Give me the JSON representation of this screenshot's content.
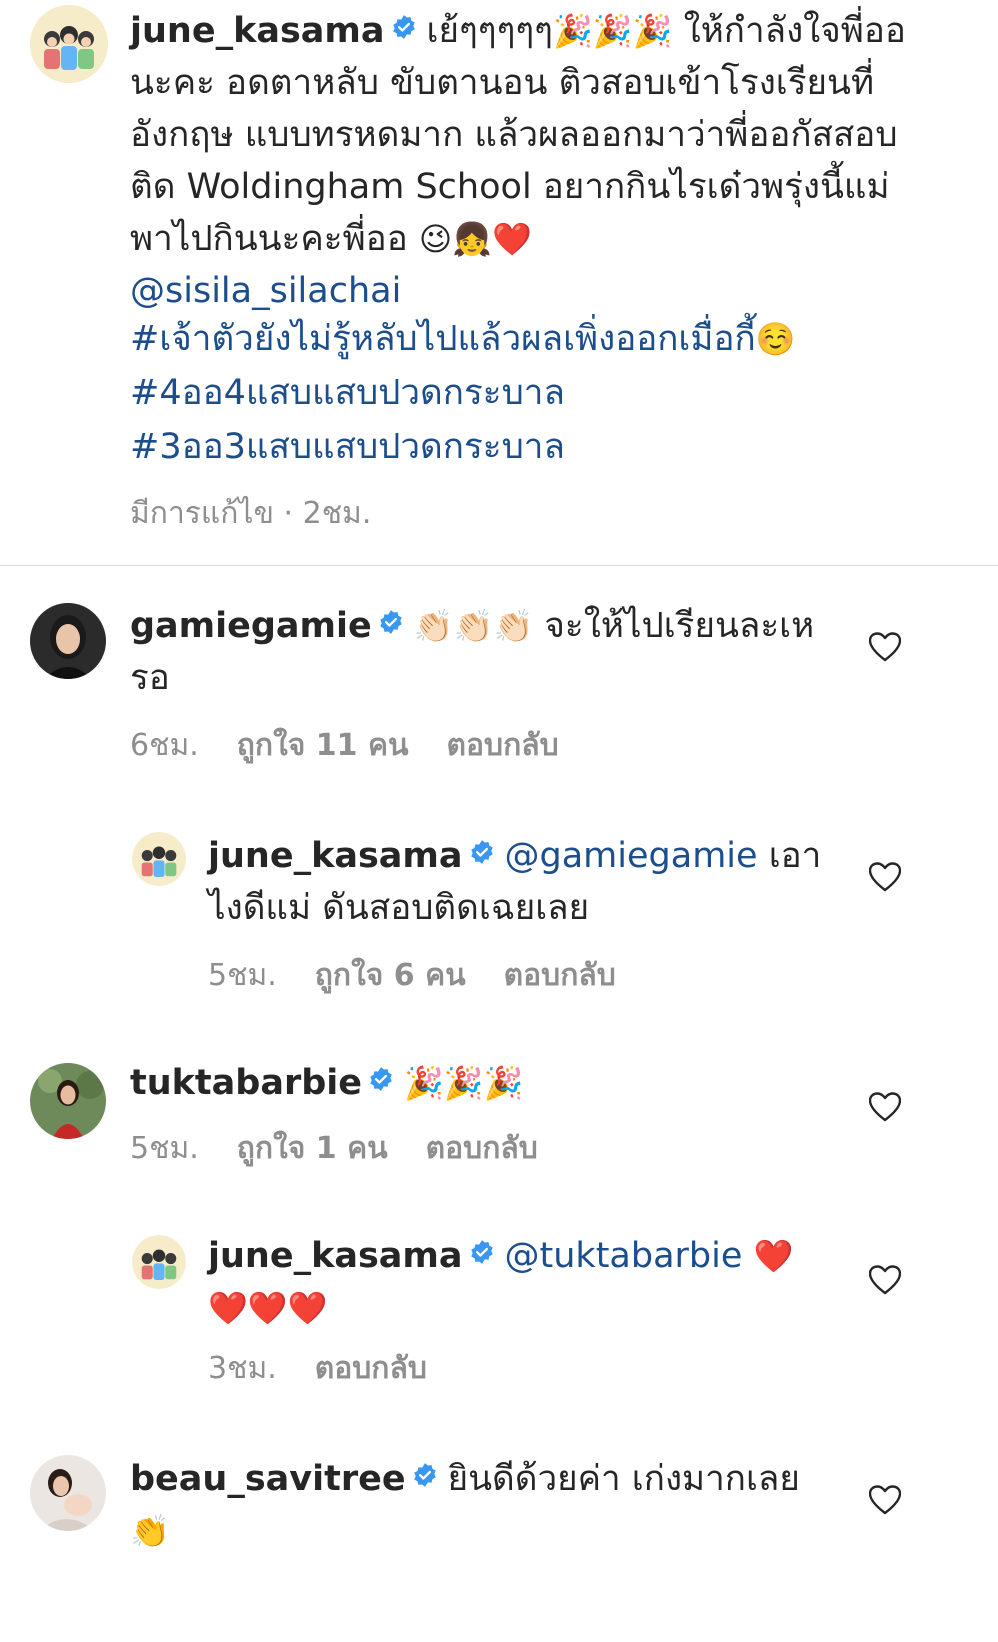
{
  "caption": {
    "username": "june_kasama",
    "text_part1": "เย้ๆๆๆๆๆ",
    "party_emojis": "🎉🎉🎉",
    "text_part2": " ให้กำลังใจพี่ออนะคะ อดตาหลับ ขับตานอน ติวสอบเข้าโรงเรียนที่อังกฤษ แบบทรหดมาก แล้วผลออกมาว่าพี่ออกัสสอบติด Woldingham School  อยากกินไรเด๋วพรุ่งนี้แม่พาไปกินนะคะพี่ออ ",
    "end_emojis": "😉👧❤️",
    "mention": "@sisila_silachai",
    "hashtags": [
      "#เจ้าตัวยังไม่รู้หลับไปแล้วผลเพิ่งออกเมื่อกี้",
      "#4ออ4แสบแสบปวดกระบาล",
      "#3ออ3แสบแสบปวดกระบาล"
    ],
    "hashtag_emoji": "☺️",
    "meta": "มีการแก้ไข · 2ชม."
  },
  "comments": [
    {
      "username": "gamiegamie",
      "emojis": "👏🏻👏🏻👏🏻",
      "text": " จะให้ไปเรียนละเหรอ",
      "time": "6ชม.",
      "likes": "ถูกใจ 11 คน",
      "reply": "ตอบกลับ"
    },
    {
      "username": "june_kasama",
      "mention": "@gamiegamie",
      "text": " เอาไงดีแม่ ดันสอบติดเฉยเลย",
      "time": "5ชม.",
      "likes": "ถูกใจ 6 คน",
      "reply": "ตอบกลับ"
    },
    {
      "username": "tuktabarbie",
      "emojis": "🎉🎉🎉",
      "time": "5ชม.",
      "likes": "ถูกใจ 1 คน",
      "reply": "ตอบกลับ"
    },
    {
      "username": "june_kasama",
      "mention": "@tuktabarbie",
      "emojis": "❤️❤️❤️❤️",
      "time": "3ชม.",
      "reply": "ตอบกลับ"
    },
    {
      "username": "beau_savitree",
      "text": "ยินดีด้วยค่า เก่งมากเลย",
      "emojis": "👏"
    }
  ],
  "colors": {
    "link": "#1c4d8c",
    "verified": "#3897f0",
    "meta": "#8e8e8e",
    "text": "#262626"
  }
}
